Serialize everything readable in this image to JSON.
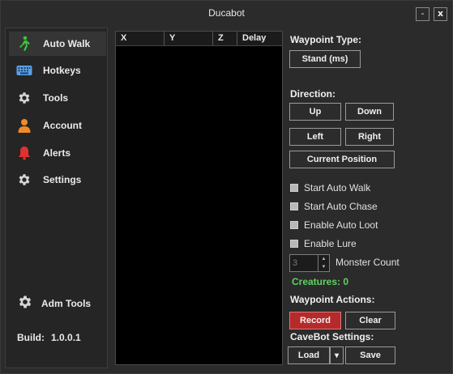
{
  "window": {
    "title": "Ducabot",
    "min_glyph": "-",
    "close_glyph": "x"
  },
  "sidebar": {
    "items": [
      {
        "label": "Auto Walk",
        "icon": "walk-icon"
      },
      {
        "label": "Hotkeys",
        "icon": "keyboard-icon"
      },
      {
        "label": "Tools",
        "icon": "gear-icon"
      },
      {
        "label": "Account",
        "icon": "user-icon"
      },
      {
        "label": "Alerts",
        "icon": "bell-icon"
      },
      {
        "label": "Settings",
        "icon": "gear-icon"
      }
    ],
    "adm_tools": "Adm Tools",
    "build_label": "Build:",
    "build_value": "1.0.0.1"
  },
  "grid": {
    "columns": [
      "X",
      "Y",
      "Z",
      "Delay"
    ],
    "rows": []
  },
  "panel": {
    "waypoint_type_label": "Waypoint Type:",
    "waypoint_type_value": "Stand (ms)",
    "direction_label": "Direction:",
    "up": "Up",
    "down": "Down",
    "left": "Left",
    "right": "Right",
    "current_position": "Current Position",
    "checks": [
      "Start Auto Walk",
      "Start Auto Chase",
      "Enable Auto Loot",
      "Enable Lure"
    ],
    "monster_count_value": "3",
    "monster_count_label": "Monster Count",
    "creatures": "Creatures: 0",
    "waypoint_actions_label": "Waypoint Actions:",
    "record": "Record",
    "clear": "Clear",
    "cavebot_label": "CaveBot Settings:",
    "load": "Load",
    "save": "Save"
  },
  "colors": {
    "accent_record": "#b52a2a",
    "creatures_green": "#5fd35f",
    "walk_icon": "#38c838",
    "keyboard_icon": "#5aa0e6",
    "user_icon": "#f08c28",
    "bell_icon": "#e03030"
  }
}
